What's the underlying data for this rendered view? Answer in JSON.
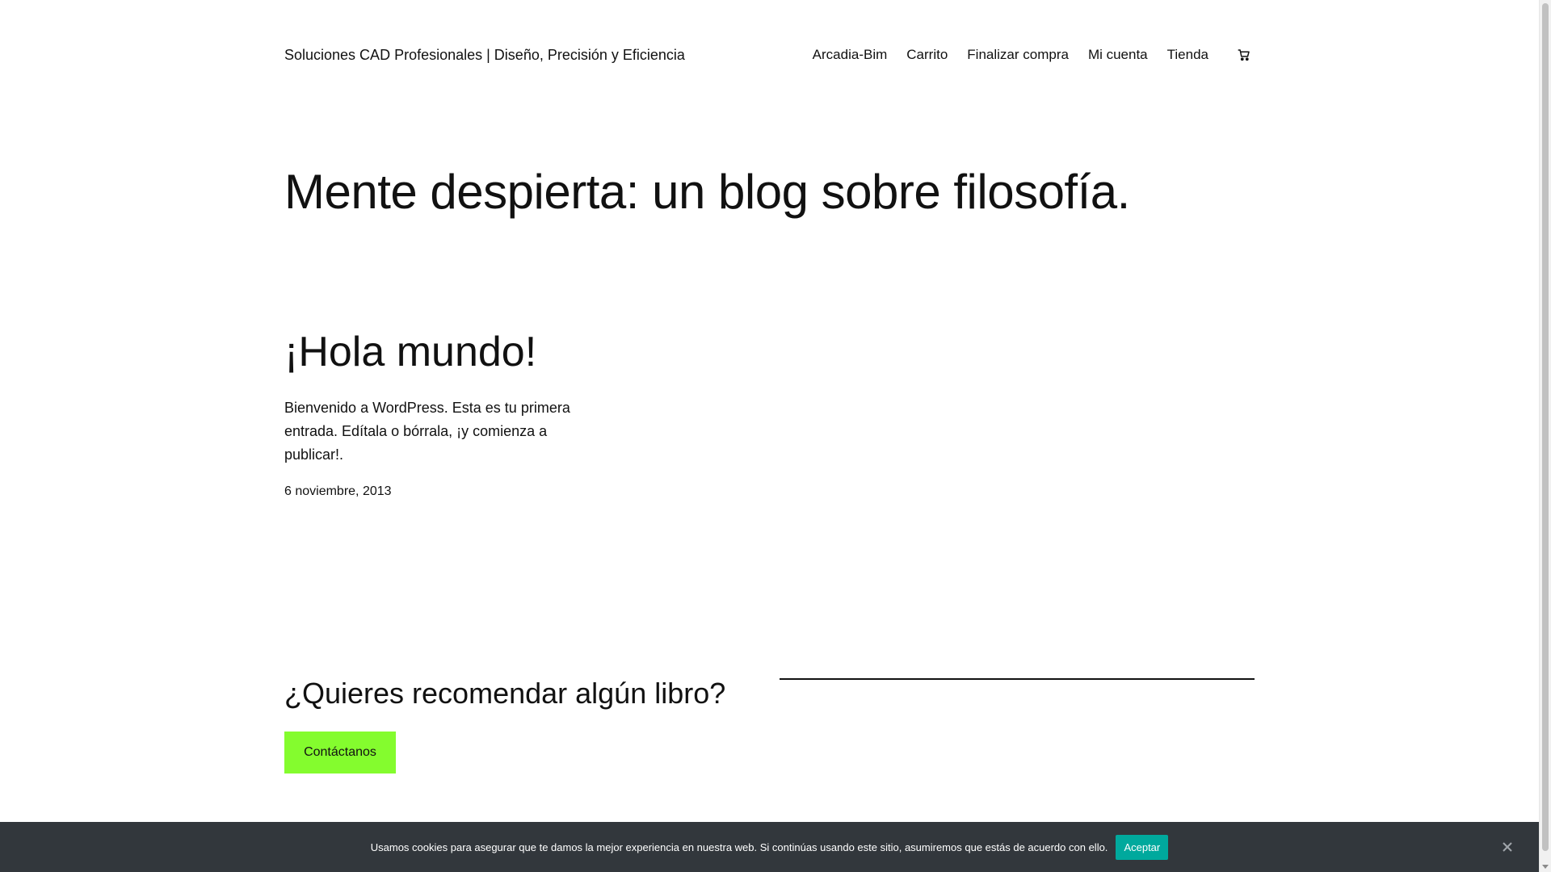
{
  "header": {
    "site_title": "Soluciones CAD Profesionales | Diseño, Precisión y Eficiencia",
    "nav": [
      {
        "label": "Arcadia-Bim"
      },
      {
        "label": "Carrito"
      },
      {
        "label": "Finalizar compra"
      },
      {
        "label": "Mi cuenta"
      },
      {
        "label": "Tienda"
      }
    ],
    "cart_icon": "cart-icon"
  },
  "main": {
    "page_title": "Mente despierta: un blog sobre filosofía.",
    "post": {
      "title": "¡Hola mundo!",
      "excerpt": "Bienvenido a WordPress. Esta es tu primera entrada. Edítala o bórrala, ¡y comienza a publicar!.",
      "date": "6 noviembre, 2013"
    }
  },
  "cta": {
    "heading": "¿Quieres recomendar algún libro?",
    "button_label": "Contáctanos",
    "button_color": "#84fc2e"
  },
  "cookie_notice": {
    "text": "Usamos cookies para asegurar que te damos la mejor experiencia en nuestra web. Si continúas usando este sitio, asumiremos que estás de acuerdo con ello.",
    "accept_label": "Aceptar",
    "close_icon": "close-icon",
    "background": "#32373c",
    "accept_color": "#00a99d"
  }
}
